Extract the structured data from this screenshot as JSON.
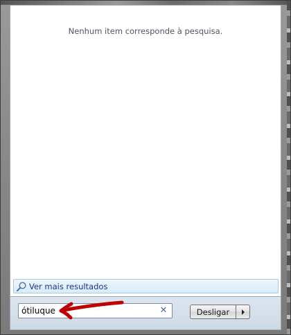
{
  "results": {
    "empty_message": "Nenhum item corresponde à pesquisa.",
    "more_results_label": "Ver mais resultados"
  },
  "search": {
    "value": "ótiluque"
  },
  "shutdown": {
    "label": "Desligar"
  },
  "icons": {
    "search": "magnifier-icon",
    "clear": "close-icon",
    "arrow": "triangle-right-icon"
  },
  "colors": {
    "link_text": "#1e3287",
    "annotation_arrow": "#c00000"
  }
}
